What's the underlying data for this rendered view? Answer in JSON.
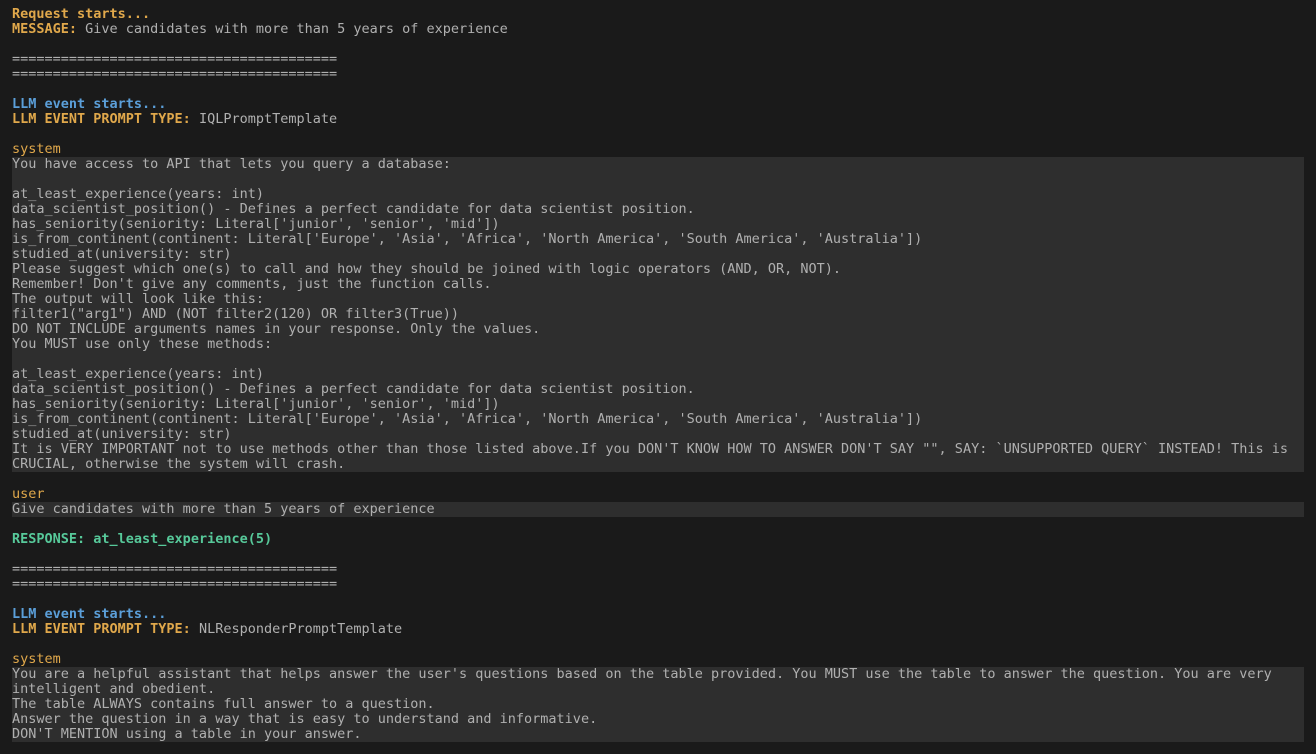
{
  "line01_request": "Request starts...",
  "line02_msg_label": "MESSAGE: ",
  "line02_msg_value": "Give candidates with more than 5 years of experience",
  "divider": "========================================",
  "line05_llm_event": "LLM event starts...",
  "line06_prompt_type_label": "LLM EVENT PROMPT TYPE: ",
  "line06_prompt_type_value": "IQLPromptTemplate",
  "system_header": "system",
  "system_body_1": "You have access to API that lets you query a database:\n\nat_least_experience(years: int)\ndata_scientist_position() - Defines a perfect candidate for data scientist position.\nhas_seniority(seniority: Literal['junior', 'senior', 'mid'])\nis_from_continent(continent: Literal['Europe', 'Asia', 'Africa', 'North America', 'South America', 'Australia'])\nstudied_at(university: str)\nPlease suggest which one(s) to call and how they should be joined with logic operators (AND, OR, NOT).\nRemember! Don't give any comments, just the function calls.\nThe output will look like this:\nfilter1(\"arg1\") AND (NOT filter2(120) OR filter3(True))\nDO NOT INCLUDE arguments names in your response. Only the values.\nYou MUST use only these methods:\n\nat_least_experience(years: int)\ndata_scientist_position() - Defines a perfect candidate for data scientist position.\nhas_seniority(seniority: Literal['junior', 'senior', 'mid'])\nis_from_continent(continent: Literal['Europe', 'Asia', 'Africa', 'North America', 'South America', 'Australia'])\nstudied_at(university: str)\nIt is VERY IMPORTANT not to use methods other than those listed above.If you DON'T KNOW HOW TO ANSWER DON'T SAY \"\", SAY: `UNSUPPORTED QUERY` INSTEAD! This is CRUCIAL, otherwise the system will crash.",
  "user_header": "user",
  "user_body": "Give candidates with more than 5 years of experience",
  "response_label": "RESPONSE: ",
  "response_value": "at_least_experience(5)",
  "line_prompt_type_value_2": "NLResponderPromptTemplate",
  "system_body_2": "You are a helpful assistant that helps answer the user's questions based on the table provided. You MUST use the table to answer the question. You are very intelligent and obedient.\nThe table ALWAYS contains full answer to a question.\nAnswer the question in a way that is easy to understand and informative.\nDON'T MENTION using a table in your answer."
}
